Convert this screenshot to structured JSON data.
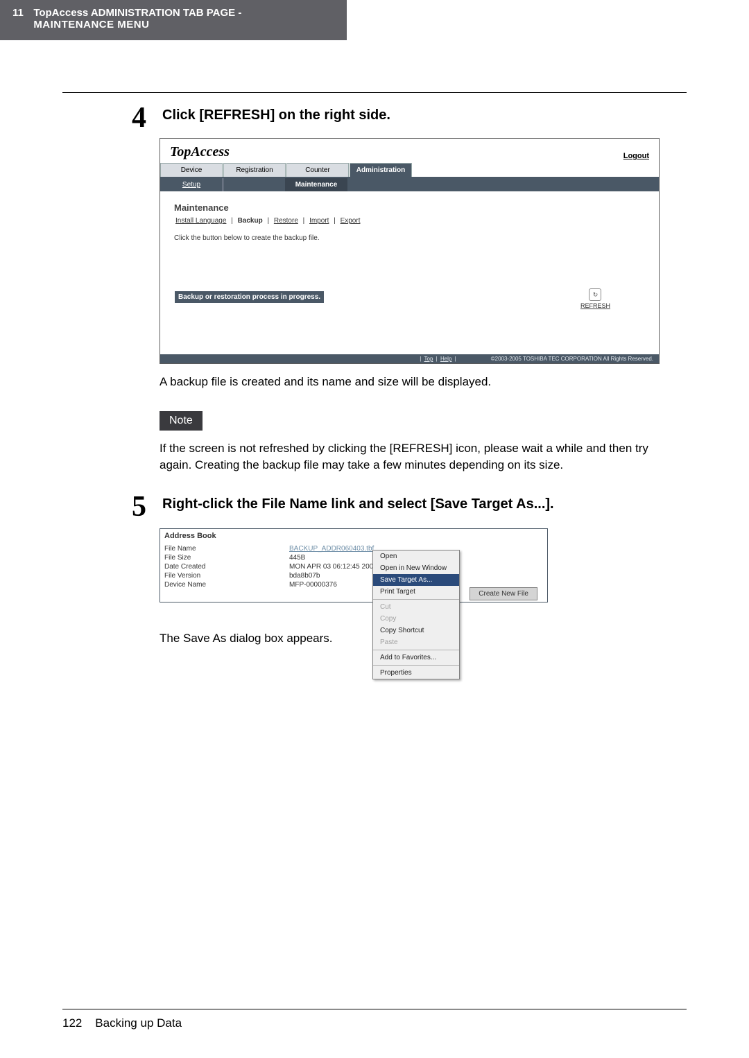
{
  "header": {
    "chapter_num": "11",
    "title": "TopAccess ADMINISTRATION TAB PAGE -",
    "subtitle": "MAINTENANCE MENU"
  },
  "step4": {
    "num": "4",
    "title": "Click [REFRESH] on the right side."
  },
  "ss1": {
    "logo": "TopAccess",
    "logout": "Logout",
    "tabs": [
      "Device",
      "Registration",
      "Counter",
      "Administration"
    ],
    "subtabs": [
      "Setup",
      "",
      "Maintenance"
    ],
    "heading": "Maintenance",
    "links": {
      "install": "Install Language",
      "backup": "Backup",
      "restore": "Restore",
      "import": "Import",
      "export": "Export"
    },
    "desc": "Click the button below to create the backup file.",
    "refresh_label": "REFRESH",
    "status": "Backup or restoration process in progress.",
    "foot_top": "Top",
    "foot_help": "Help",
    "foot_copy": "©2003-2005 TOSHIBA TEC CORPORATION All Rights Reserved."
  },
  "para1": "A backup file is created and its name and size will be displayed.",
  "note_label": "Note",
  "para2": "If the screen is not refreshed by clicking the [REFRESH] icon, please wait a while and then try again. Creating the backup file may take a few minutes depending on its size.",
  "step5": {
    "num": "5",
    "title": "Right-click the File Name link and select [Save Target As...]."
  },
  "ss2": {
    "heading": "Address Book",
    "rows": [
      {
        "k": "File Name",
        "v": "BACKUP_ADDR060403.tbf",
        "link": true
      },
      {
        "k": "File Size",
        "v": "445B"
      },
      {
        "k": "Date Created",
        "v": "MON APR 03 06:12:45 200"
      },
      {
        "k": "File Version",
        "v": "bda8b07b"
      },
      {
        "k": "Device Name",
        "v": "MFP-00000376"
      }
    ],
    "create_btn": "Create New File"
  },
  "context_menu": {
    "open": "Open",
    "open_new": "Open in New Window",
    "save_as": "Save Target As...",
    "print": "Print Target",
    "cut": "Cut",
    "copy": "Copy",
    "copy_shortcut": "Copy Shortcut",
    "paste": "Paste",
    "add_fav": "Add to Favorites...",
    "props": "Properties"
  },
  "para3": "The Save As dialog box appears.",
  "footer": {
    "page_num": "122",
    "section": "Backing up Data"
  }
}
